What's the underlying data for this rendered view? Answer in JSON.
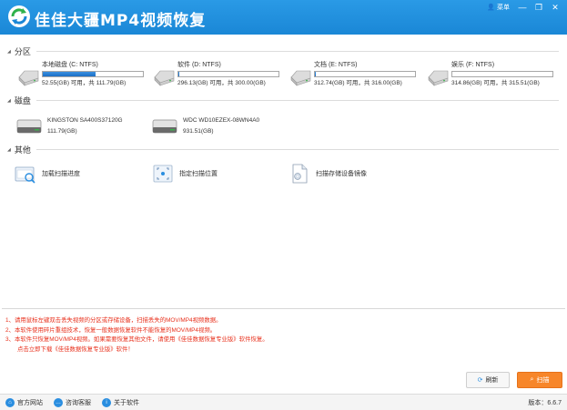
{
  "app": {
    "title": "佳佳大疆MP4视频恢复",
    "menu_label": "菜单",
    "min_glyph": "—",
    "max_glyph": "❐",
    "close_glyph": "✕"
  },
  "sections": {
    "partitions": "分区",
    "disks": "磁盘",
    "others": "其他"
  },
  "partitions": [
    {
      "name": "本地磁盘 (C: NTFS)",
      "size": "52.55(GB) 可用，共 111.79(GB)",
      "used_fraction": 0.53
    },
    {
      "name": "软件 (D: NTFS)",
      "size": "296.13(GB) 可用，共 300.00(GB)",
      "used_fraction": 0.013
    },
    {
      "name": "文档 (E: NTFS)",
      "size": "312.74(GB) 可用，共 316.00(GB)",
      "used_fraction": 0.01
    },
    {
      "name": "娱乐 (F: NTFS)",
      "size": "314.86(GB) 可用，共 315.51(GB)",
      "used_fraction": 0.002
    }
  ],
  "disks": [
    {
      "name": "KINGSTON SA400S37120G",
      "size": "111.79(GB)"
    },
    {
      "name": "WDC WD10EZEX-08WN4A0",
      "size": "931.51(GB)"
    }
  ],
  "others": [
    {
      "label": "加载扫描进度",
      "icon": "load-progress-icon"
    },
    {
      "label": "指定扫描位置",
      "icon": "scan-location-icon"
    },
    {
      "label": "扫描存储设备镜像",
      "icon": "disk-image-icon"
    }
  ],
  "notes": [
    "1、请用鼠标左键双击丢失视频的分区或存储设备，扫描丢失的MOV/MP4视频数据。",
    "2、本软件使用碎片重组技术，恢复一般数据恢复软件不能恢复的MOV/MP4视频。",
    "3、本软件只恢复MOV/MP4视频。如果需要恢复其他文件，请使用《佳佳数据恢复专业版》软件恢复。",
    "点击立即下载《佳佳数据恢复专业版》软件！"
  ],
  "buttons": {
    "refresh": "刷新",
    "scan": "扫描"
  },
  "footer": {
    "website": "官方网站",
    "support": "咨询客服",
    "about": "关于软件",
    "version": "版本：6.6.7"
  },
  "colors": {
    "titlebar": "#1a87d6",
    "accent_orange": "#f7862a",
    "note_red": "#e8301c",
    "usage_blue": "#1c6fc5"
  }
}
